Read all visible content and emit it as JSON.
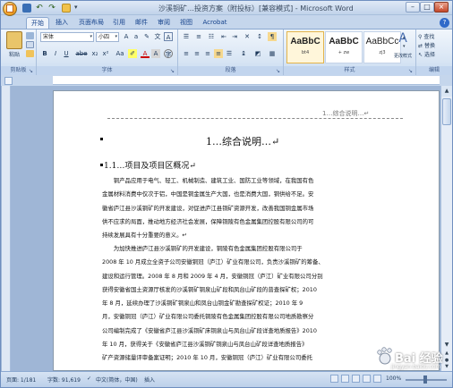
{
  "window": {
    "title": "沙溪铜矿…投资方案（附投标）[兼容模式] - Microsoft Word"
  },
  "quick_access": {
    "save": "save-icon",
    "undo": "↶",
    "redo": "↷",
    "more": "▾"
  },
  "tabs": [
    "开始",
    "插入",
    "页面布局",
    "引用",
    "邮件",
    "审阅",
    "视图",
    "Acrobat"
  ],
  "ribbon": {
    "clipboard": {
      "paste": "粘贴",
      "label": "剪贴板"
    },
    "font": {
      "name": "宋体",
      "size": "小四",
      "label": "字体",
      "buttons": [
        "B",
        "I",
        "U",
        "abe",
        "x₂",
        "x²",
        "Aa",
        "A",
        "A"
      ]
    },
    "paragraph": {
      "label": "段落"
    },
    "styles": {
      "label": "样式",
      "items": [
        {
          "sample": "AaBbC",
          "name": "bt4"
        },
        {
          "sample": "AaBbC",
          "name": "+ zw"
        },
        {
          "sample": "AaBbCc",
          "name": "zj3"
        }
      ],
      "change": "更改样式"
    },
    "editing": {
      "label": "编辑",
      "find": "查找",
      "replace": "替换",
      "select": "选择"
    }
  },
  "document": {
    "header_text": "1…综合说明…↵",
    "chapter_title": "1…综合说明…↵",
    "section_title": "1.1…项目及项目区概况↵",
    "para1": [
      "　　铜产品应用于电气、轻工、机械制造、建筑工业、国防工业等领域，在我国有色",
      "金属材料消费中仅次于铝，中国是铜金属生产大国，也是消费大国，铜供给不足。安",
      "徽省庐江县沙溪铜矿的开发建设，对促进庐江县铜矿资源开发，改善我国铜金属市场",
      "供不应求的局面，推动地方经济社会发展，保障铜陵有色金属集团控股有限公司的可",
      "持续发展具有十分重要的意义。↵"
    ],
    "para2": [
      "　　为加快推进庐江县沙溪铜矿的开发建设，铜陵有色金属集团控股有限公司于",
      "2008 年 10 月成立全资子公司安徽铜冠（庐江）矿业有限公司，负责沙溪铜矿的筹备、",
      "建设和运行管理。2008 年 8 月和 2009 年 4 月，安徽铜冠（庐江）矿业有限公司分别",
      "获得安徽省国土资源厅核发的沙溪铜矿铜泉山矿段和凤台山矿段的普查探矿权；2010",
      "年 8 月，延续办理了沙溪铜矿铜泉山和凤台山铜金矿勘查探矿权证；2010 年 9",
      "月，安徽铜冠（庐江）矿业有限公司委托铜陵有色金属集团控股有限公司地质勘察分",
      "公司编制完成了《安徽省庐江县沙溪铜矿床铜泉山与凤台山矿段详查地质报告》2010",
      "年 10 月，获得关于《安徽省庐江县沙溪铜矿铜泉山与凤台山矿段详查地质报告》",
      "矿产资源储量评审备案证明；2010 年 10 月，安徽铜冠（庐江）矿业有限公司委托"
    ]
  },
  "status_bar": {
    "page": "页面: 1/181",
    "words": "字数: 91,619",
    "lang": "中文(简体，中国)",
    "mode": "插入",
    "zoom": "100%"
  },
  "watermark": {
    "text": "Bai 经验",
    "url": "jingyan.baidu.com"
  },
  "colors": {
    "ribbon": "#dbe7f5",
    "accent": "#15428b",
    "frame": "#c5d6ec"
  }
}
